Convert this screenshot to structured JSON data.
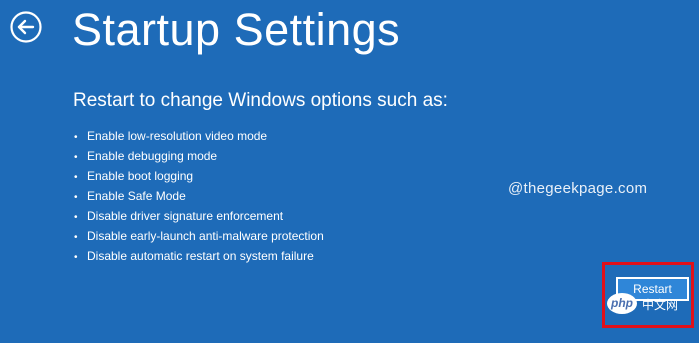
{
  "header": {
    "title": "Startup Settings",
    "back_icon": "back-arrow-icon"
  },
  "main": {
    "subtitle": "Restart to change Windows options such as:",
    "bullet_symbol": "•",
    "options": [
      "Enable low-resolution video mode",
      "Enable debugging mode",
      "Enable boot logging",
      "Enable Safe Mode",
      "Disable driver signature enforcement",
      "Disable early-launch anti-malware protection",
      "Disable automatic restart on system failure"
    ]
  },
  "watermark": "@thegeekpage.com",
  "footer": {
    "restart_label": "Restart",
    "highlight_color": "#e0101a"
  },
  "overlay_logo": {
    "logo_text": "php",
    "site_text": "中文网"
  },
  "colors": {
    "background": "#1e6bb8",
    "foreground": "#ffffff"
  }
}
